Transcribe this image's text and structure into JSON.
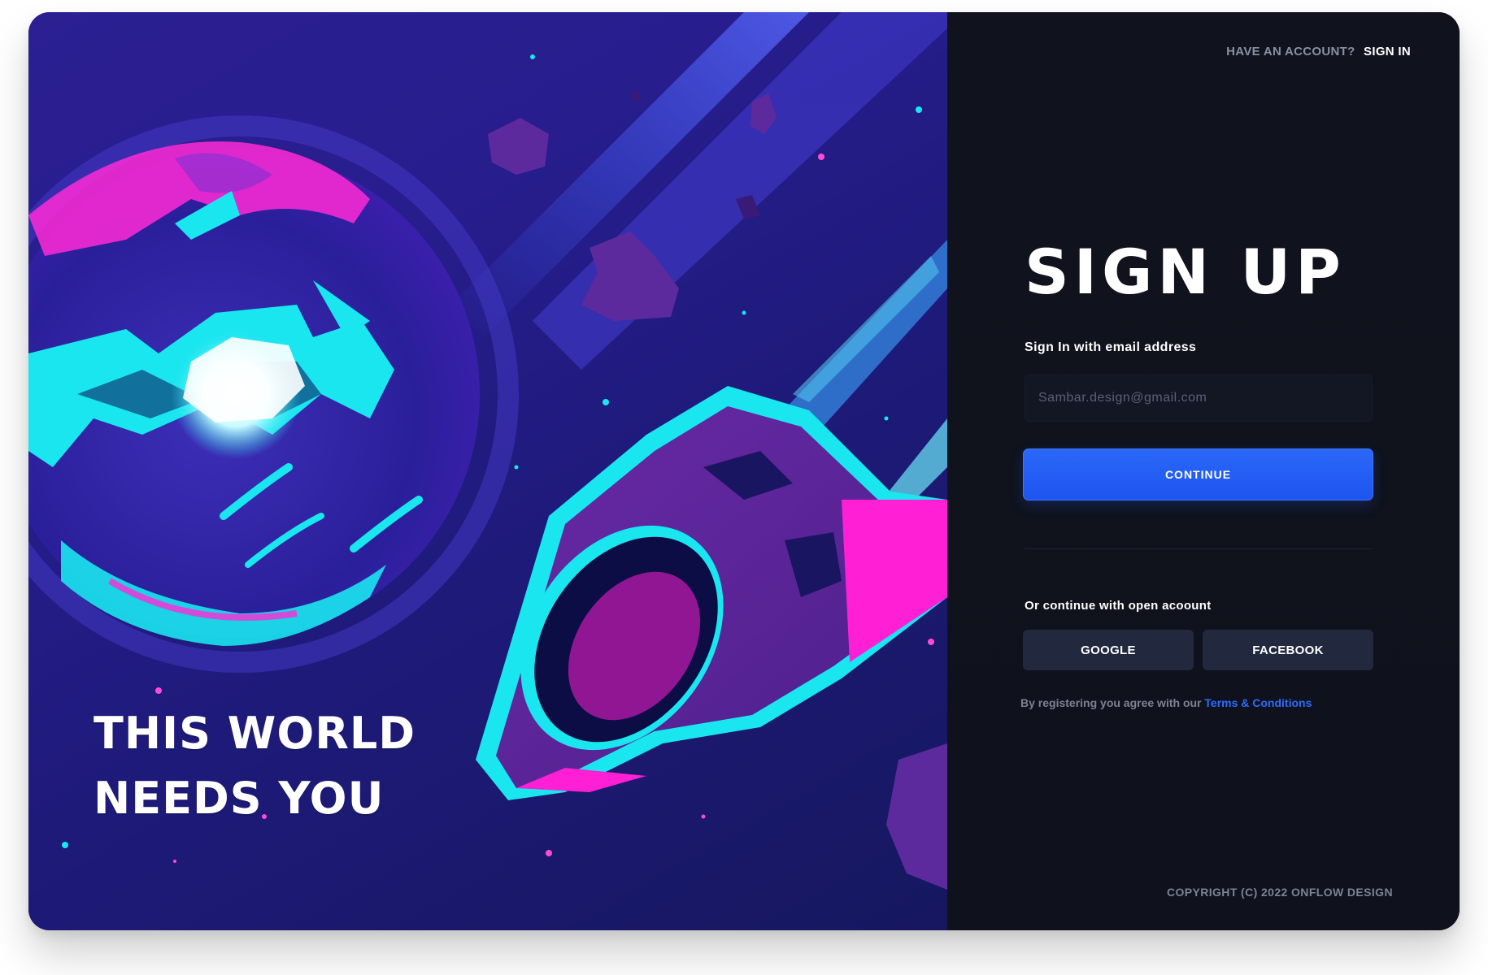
{
  "hero": {
    "tagline_line1": "THIS WORLD",
    "tagline_line2": "NEEDS YOU"
  },
  "header": {
    "have_account_text": "HAVE AN ACCOUNT?",
    "sign_in_link": "SIGN IN"
  },
  "form": {
    "title": "SIGN UP",
    "email_label": "Sign In with email address",
    "email_placeholder": "Sambar.design@gmail.com",
    "continue_button": "CONTINUE"
  },
  "social": {
    "label": "Or  continue with open  acoount",
    "google_button": "GOOGLE",
    "facebook_button": "FACEBOOK"
  },
  "terms": {
    "prefix": "By registering you agree with our",
    "link": "Terms & Conditions"
  },
  "footer": {
    "copyright": "COPYRIGHT (C) 2022 ONFLOW DESIGN"
  },
  "colors": {
    "accent": "#2a68f8",
    "panel_bg": "#0f121c",
    "social_button_bg": "#22283d",
    "link": "#2f6bff"
  }
}
